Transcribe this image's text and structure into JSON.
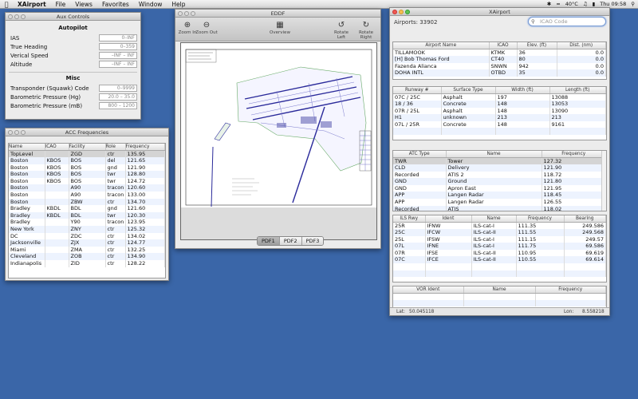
{
  "menubar": {
    "app": "XAirport",
    "items": [
      "File",
      "Views",
      "Favorites",
      "Window",
      "Help"
    ],
    "temperature": "40°C",
    "clock": "Thu 09:58"
  },
  "aux": {
    "title": "Aux Controls",
    "autopilot_title": "Autopilot",
    "autopilot_fields": [
      {
        "label": "IAS",
        "placeholder": "0–INF"
      },
      {
        "label": "True Heading",
        "placeholder": "0–359"
      },
      {
        "label": "Verical Speed",
        "placeholder": "–INF – INF"
      },
      {
        "label": "Altitude",
        "placeholder": "–INF – INF"
      }
    ],
    "misc_title": "Misc",
    "misc_fields": [
      {
        "label": "Transponder (Squawk) Code",
        "placeholder": "0–9999"
      },
      {
        "label": "Barometric Pressure (Hg)",
        "placeholder": "20.0 – 35.0"
      },
      {
        "label": "Barometric Pressure (mB)",
        "placeholder": "800 – 1200"
      }
    ]
  },
  "acc": {
    "title": "ACC Frequencies",
    "columns": [
      "Name",
      "ICAO",
      "Facility",
      "Role",
      "Frequency"
    ],
    "rows": [
      [
        "TopLevel",
        "",
        "ZGD",
        "ctr",
        "135.95"
      ],
      [
        "Boston",
        "KBOS",
        "BOS",
        "del",
        "121.65"
      ],
      [
        "Boston",
        "KBOS",
        "BOS",
        "gnd",
        "121.90"
      ],
      [
        "Boston",
        "KBOS",
        "BOS",
        "twr",
        "128.80"
      ],
      [
        "Boston",
        "KBOS",
        "BOS",
        "twr",
        "124.72"
      ],
      [
        "Boston",
        "",
        "A90",
        "tracon",
        "120.60"
      ],
      [
        "Boston",
        "",
        "A90",
        "tracon",
        "133.00"
      ],
      [
        "Boston",
        "",
        "ZBW",
        "ctr",
        "134.70"
      ],
      [
        "Bradley",
        "KBDL",
        "BDL",
        "gnd",
        "121.60"
      ],
      [
        "Bradley",
        "KBDL",
        "BDL",
        "twr",
        "120.30"
      ],
      [
        "Bradley",
        "",
        "Y90",
        "tracon",
        "123.95"
      ],
      [
        "New York",
        "",
        "ZNY",
        "ctr",
        "125.32"
      ],
      [
        "DC",
        "",
        "ZDC",
        "ctr",
        "134.02"
      ],
      [
        "Jacksonville",
        "",
        "ZJX",
        "ctr",
        "124.77"
      ],
      [
        "Miami",
        "",
        "ZMA",
        "ctr",
        "132.25"
      ],
      [
        "Cleveland",
        "",
        "ZOB",
        "ctr",
        "134.90"
      ],
      [
        "Indianapolis",
        "",
        "ZID",
        "ctr",
        "128.22"
      ]
    ]
  },
  "eddf": {
    "title": "EDDF",
    "toolbar": {
      "zoom_in": "Zoom In",
      "zoom_out": "Zoom Out",
      "overview": "Overview",
      "rotate_left": "Rotate Left",
      "rotate_right": "Rotate Right"
    },
    "pdf_tabs": [
      "PDF1",
      "PDF2",
      "PDF3"
    ]
  },
  "xairport": {
    "title": "XAirport",
    "airports_count": "Airports: 33902",
    "search_placeholder": "ICAO Code",
    "airports": {
      "columns": [
        "Airport Name",
        "ICAO",
        "Elev. (ft)",
        "Dist. (nm)"
      ],
      "rows": [
        [
          "TILLAMOOK",
          "KTMK",
          "36",
          "0.0"
        ],
        [
          "[H] Bob Thomas Ford",
          "CT40",
          "80",
          "0.0"
        ],
        [
          "Fazenda Alianca",
          "SNWN",
          "942",
          "0.0"
        ],
        [
          "DOHA INTL",
          "OTBD",
          "35",
          "0.0"
        ]
      ]
    },
    "runways": {
      "columns": [
        "Runway #",
        "Surface Type",
        "Width (ft)",
        "Length (ft)"
      ],
      "rows": [
        [
          "07C / 25C",
          "Asphalt",
          "197",
          "13088"
        ],
        [
          "18 / 36",
          "Concrete",
          "148",
          "13053"
        ],
        [
          "07R / 25L",
          "Asphalt",
          "148",
          "13090"
        ],
        [
          "H1",
          "unknown",
          "213",
          "213"
        ],
        [
          "07L / 25R",
          "Concrete",
          "148",
          "9161"
        ]
      ]
    },
    "atc": {
      "columns": [
        "ATC Type",
        "Name",
        "Frequency"
      ],
      "rows": [
        [
          "TWR",
          "Tower",
          "127.32"
        ],
        [
          "CLD",
          "Delivery",
          "121.90"
        ],
        [
          "Recorded",
          "ATIS 2",
          "118.72"
        ],
        [
          "GND",
          "Ground",
          "121.80"
        ],
        [
          "GND",
          "Apron East",
          "121.95"
        ],
        [
          "APP",
          "Langen Radar",
          "118.45"
        ],
        [
          "APP",
          "Langen Radar",
          "126.55"
        ],
        [
          "Recorded",
          "ATIS",
          "118.02"
        ]
      ]
    },
    "ils": {
      "columns": [
        "ILS Rwy",
        "Ident",
        "Name",
        "Frequency",
        "Bearing"
      ],
      "rows": [
        [
          "25R",
          "IFNW",
          "ILS-cat-I",
          "111.35",
          "249.586"
        ],
        [
          "25C",
          "IFCW",
          "ILS-cat-II",
          "111.55",
          "249.568"
        ],
        [
          "25L",
          "IFSW",
          "ILS-cat-I",
          "111.15",
          "249.57"
        ],
        [
          "07L",
          "IFNE",
          "ILS-cat-I",
          "111.75",
          "69.586"
        ],
        [
          "07R",
          "IFSE",
          "ILS-cat-II",
          "110.95",
          "69.619"
        ],
        [
          "07C",
          "IFCE",
          "ILS-cat-II",
          "110.55",
          "69.614"
        ]
      ]
    },
    "vor": {
      "columns": [
        "VOR Ident",
        "Name",
        "Frequency"
      ],
      "rows": []
    },
    "status": {
      "lat_label": "Lat:",
      "lat_value": "50.045118",
      "lon_label": "Lon:",
      "lon_value": "8.558218"
    }
  }
}
